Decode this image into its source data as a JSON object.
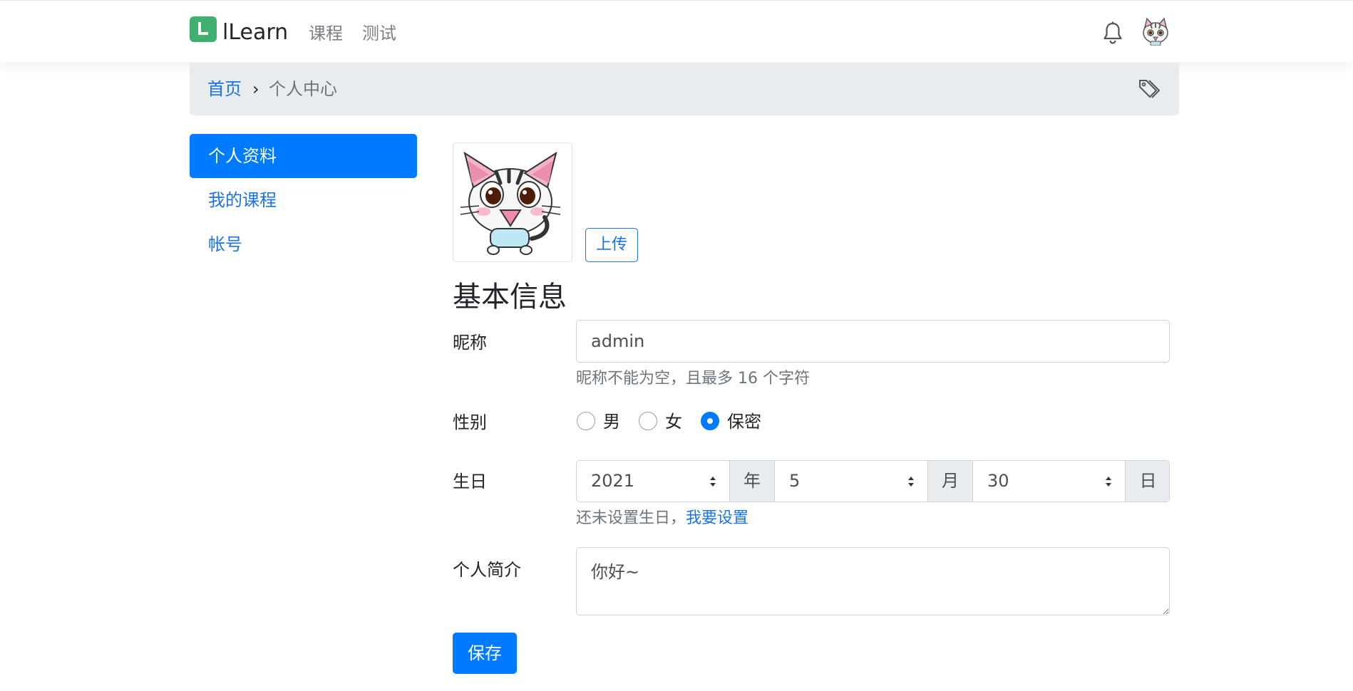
{
  "navbar": {
    "brand": "lLearn",
    "links": [
      "课程",
      "测试"
    ],
    "icons": {
      "notifications": "bell-icon",
      "user": "avatar"
    }
  },
  "breadcrumb": {
    "home": "首页",
    "separator": "›",
    "current": "个人中心",
    "icon": "tag-icon"
  },
  "sidebar": {
    "items": [
      {
        "label": "个人资料",
        "active": true
      },
      {
        "label": "我的课程",
        "active": false
      },
      {
        "label": "帐号",
        "active": false
      }
    ]
  },
  "profile": {
    "upload_label": "上传",
    "section_title": "基本信息",
    "nickname": {
      "label": "昵称",
      "value": "admin",
      "help": "昵称不能为空，且最多 16 个字符"
    },
    "gender": {
      "label": "性别",
      "options": [
        "男",
        "女",
        "保密"
      ],
      "selected": "保密"
    },
    "birthday": {
      "label": "生日",
      "year": "2021",
      "year_unit": "年",
      "month": "5",
      "month_unit": "月",
      "day": "30",
      "day_unit": "日",
      "help": "还未设置生日，",
      "help_link": "我要设置"
    },
    "bio": {
      "label": "个人简介",
      "value": "你好~"
    },
    "save_label": "保存"
  },
  "colors": {
    "primary": "#007bff",
    "link": "#1a73e8",
    "brand": "#3fb06f",
    "breadcrumb_bg": "#e9ecef"
  }
}
